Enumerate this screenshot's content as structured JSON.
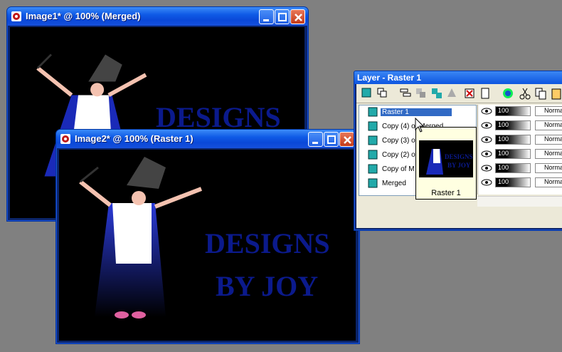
{
  "image1": {
    "title": "Image1* @ 100% (Merged)"
  },
  "image2": {
    "title": "Image2* @ 100% (Raster 1)"
  },
  "art": {
    "line1": "DESIGNS",
    "line2": "BY JOY"
  },
  "layer_palette": {
    "title": "Layer - Raster 1",
    "layers": [
      {
        "name": "Raster 1",
        "selected": true,
        "opacity": "100",
        "blend": "Normal"
      },
      {
        "name": "Copy (4) of Merged",
        "opacity": "100",
        "blend": "Normal"
      },
      {
        "name": "Copy (3) of",
        "opacity": "100",
        "blend": "Normal"
      },
      {
        "name": "Copy (2) of",
        "opacity": "100",
        "blend": "Normal"
      },
      {
        "name": "Copy of M",
        "opacity": "100",
        "blend": "Normal"
      },
      {
        "name": "Merged",
        "opacity": "100",
        "blend": "Normal"
      }
    ],
    "tooltip": {
      "caption": "Raster 1"
    }
  },
  "colors": {
    "canvas": "#000000",
    "art_text": "#0b1a8c",
    "robe": "#1a2ab8",
    "hat": "#3a3a3a",
    "selection": "#316ac5"
  }
}
